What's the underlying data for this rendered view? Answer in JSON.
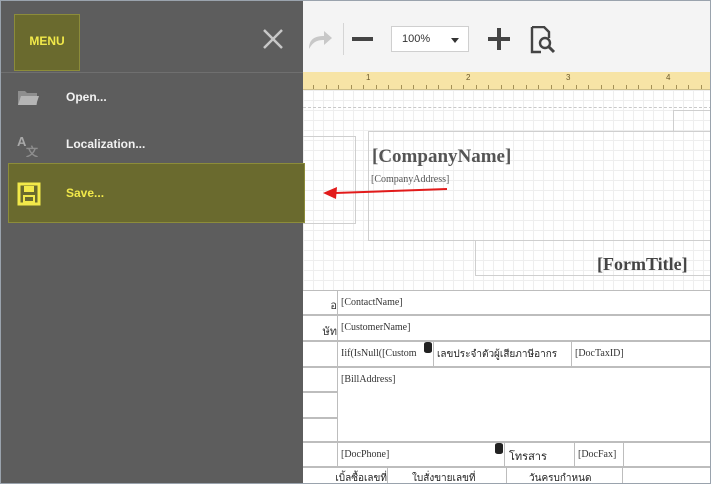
{
  "menu": {
    "button_label": "MENU",
    "items": [
      {
        "label": "Open...",
        "icon": "folder-icon"
      },
      {
        "label": "Localization...",
        "icon": "translate-icon"
      },
      {
        "label": "Save...",
        "icon": "save-icon"
      }
    ],
    "active_item": "Save...",
    "accent_color": "#f2e94a"
  },
  "toolbar": {
    "zoom_value": "100%"
  },
  "ruler": {
    "numbers": [
      "1",
      "2",
      "3",
      "4"
    ]
  },
  "report": {
    "company_name": "[CompanyName]",
    "company_address": "[CompanyAddress]",
    "form_title": "[FormTitle]",
    "fields": {
      "contact_name": "[ContactName]",
      "customer_name": "[CustomerName]",
      "iif_expr": "Iif(IsNull([Custom",
      "tax_label": "เลขประจำตัวผู้เสียภาษีอากร",
      "doc_tax_id": "[DocTaxID]",
      "bill_address": "[BillAddress]",
      "doc_phone": "[DocPhone]",
      "fax_label": "โทรสาร",
      "doc_fax": "[DocFax]"
    },
    "left_partial_labels": [
      "อ",
      "ษัท"
    ],
    "bottom_partial_labels": [
      "เบิ้ลซื้อเลขที่",
      "ใบสั่งขายเลขที่",
      "วันครบกำหนด"
    ]
  }
}
